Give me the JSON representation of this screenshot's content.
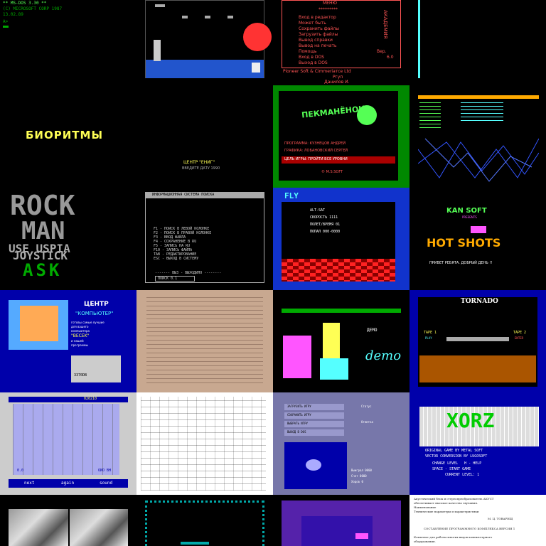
{
  "tiles": {
    "r1c1": {
      "lines": [
        "** MS-DOS 3.30 **",
        "(C) MICROSOFT CORP 1987",
        "13.02.89",
        "A>"
      ]
    },
    "r1c3": {
      "header": "МЕНЮ",
      "divider": "*********",
      "items": [
        "Вход в редактор",
        "Может быть",
        "Сохранить файлы",
        "Загрузить файлы",
        "Вывод справки",
        "Вывод на печать",
        "Помощь",
        "Вход в DOS",
        "Выход в DOS"
      ],
      "side_text": "АКАДЕМИЯ",
      "version_label": "Вер.",
      "version": "6.0",
      "footer1": "Pioneer Soft & Cimmeriaтce Ltd",
      "footer2": "Ргуп",
      "footer3": "Данилов И."
    },
    "r2c1": {
      "title": "БИОРИТМЫ",
      "credit1": "ЦЕНТР \"ЕНИГ\"",
      "credit2": "ВВЕДИТЕ ДАТУ 1990"
    },
    "r2c3": {
      "title": "ПЕКМАНЁНОК",
      "credit1": "ПРОГРАММА: КУЗНЕЦОВ АНДРЕЙ",
      "credit2": "ГРАФИКА: ЛОБАНОВСКИЙ СЕРГЕЙ",
      "credit3": "ЦЕЛЬ ИГРЫ: ПРОЙТИ ВСЕ УРОВНИ",
      "copyright": "© M.S.SOFT"
    },
    "r3c1": {
      "line1": "ROCK",
      "line2": "MAN",
      "line3": "USE USPIA",
      "line4": "JOYSTICK",
      "line5": "ASK"
    },
    "r3c2": {
      "title": "ИНФОРМАЦИОННАЯ СИСТЕМА ПОИСКА",
      "menu": [
        "F1 - ПОИСК В ЛЕВОЙ КОЛОНКЕ",
        "F2 - ПОИСК В ПРАВОЙ КОЛОНКЕ",
        "F3 - ВВОД ФАЙЛА",
        "F4 - СОХРАНЕНИЕ В RU",
        "F5 - ЗАПИСЬ НА RU",
        "F10 - ЗАПИСЬ ФАЙЛА",
        "TAB - РЕДАКТИРОВАНИЕ",
        "ESC - ВЫХОД В СИСТЕМУ"
      ],
      "footer": "------- ВЫЗ - ВЫХОДИЛО --------",
      "status": "ПОИСК 0.1"
    },
    "r3c3": {
      "logo": "FLY",
      "lines": [
        "ALT-SAT",
        "СКОРОСТЬ 1111",
        "ПОЛЕТ/ВРЕМЯ 01",
        "ПОПАЛ 000-0000"
      ]
    },
    "r3c4": {
      "brand": "KAN SOFT",
      "presents": "PRESENTS",
      "title": "HOT SHOTS",
      "greeting": "ПРИВЕТ РЕБЯТА. ДОБРЫЙ ДЕНЬ !!"
    },
    "r4c1": {
      "title": "ЦЕНТР",
      "subtitle": "\"КОМПЬЮТЕР\"",
      "body": [
        "готовы самые лучшие",
        "для вашего",
        "компьютера",
        "\"BECEK\"",
        "и нашей",
        "программы"
      ],
      "phone": "3370DB"
    },
    "r4c3": {
      "header": "ДЕМО",
      "demo": "demo"
    },
    "r4c4": {
      "title": "TORNADO",
      "p1": "ТАРЕ 1",
      "p2": "ТАРЕ 2",
      "p1s": "PLAY",
      "p2s": "ENTER"
    },
    "r5c1": {
      "btn1": "next",
      "btn2": "again",
      "btn3": "sound",
      "score": "020210",
      "left": "0.0",
      "right": "ОИО ВН"
    },
    "r5c3": {
      "btn1": "ЗАГРУЗИТЬ ИГРУ",
      "btn2": "СОХРАНИТЬ ИГРУ",
      "btn3": "ВЫБРАТЬ ИГРУ",
      "btn4": "ВЫХОД В DOS",
      "label1": "Статус",
      "label2": "Отметка",
      "stat1": "Выиграл 0000",
      "stat2": "Счет 0000",
      "stat3": "Ходов 0"
    },
    "r5c4": {
      "title": "XORZ",
      "line1": "ORIGINAL GAME BY METAL SOFT",
      "line2": "VECTOR CONVERSION BY LUGOSOFT",
      "line3": "CHANGE LEVEL   H - HELP",
      "line4": "SPACE - START GAME",
      "level": "CURRENT LEVEL: 1"
    },
    "r6c4": {
      "lines": [
        "Акустический блок и стереопреобразователь АКУСТ",
        "обеспечивает высокое качество звучания.",
        "Наименование",
        "Технические параметры и характеристики",
        "М. Ц. ТОВАРИЩ",
        "СОСТАВЛЕНИЕ ПРОГРАММНОГО КОМПЛЕКСА ВЕРСИЯ 1",
        "Комплекс для работы многих видов компьютерного",
        "оборудования."
      ]
    }
  },
  "colors": {
    "cga_red": "#aa0000",
    "bright_red": "#ff5555",
    "green": "#00aa00",
    "bright_green": "#55ff55",
    "yellow": "#ffff55",
    "cyan": "#55ffff",
    "blue": "#0000aa",
    "magenta": "#ff55ff",
    "gray": "#aaaaaa"
  }
}
